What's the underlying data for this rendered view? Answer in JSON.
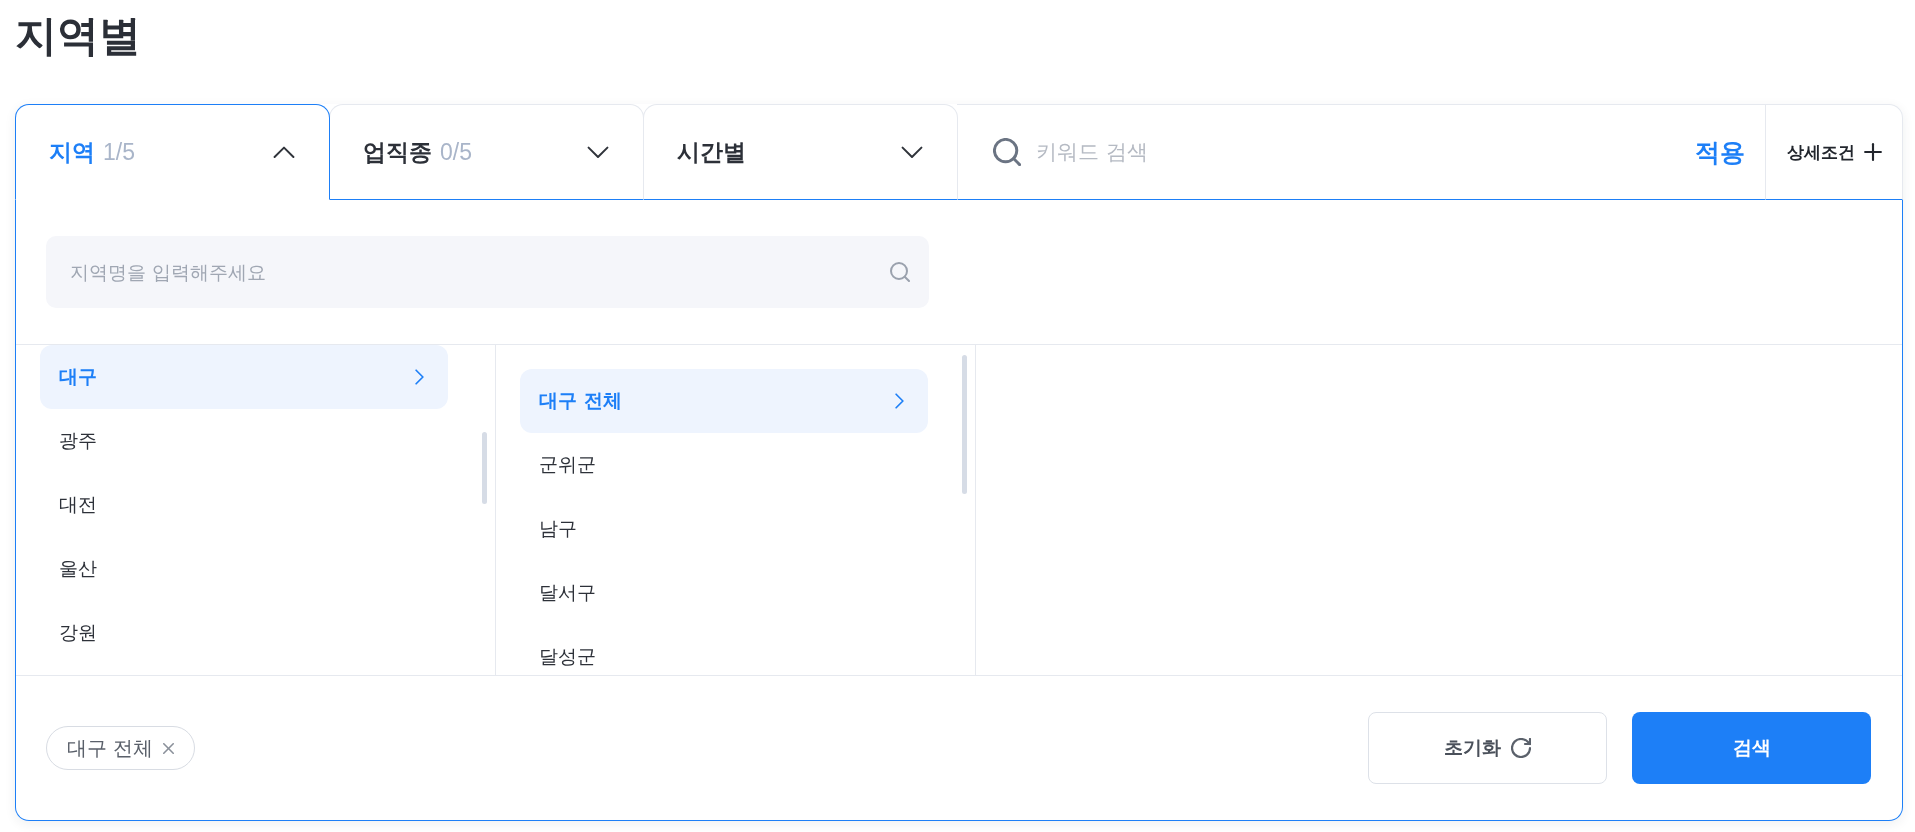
{
  "page_title": "지역별",
  "filter_tabs": [
    {
      "label": "지역",
      "count": "1/5",
      "selected": true,
      "expanded": true
    },
    {
      "label": "업직종",
      "count": "0/5",
      "selected": false,
      "expanded": false
    },
    {
      "label": "시간별",
      "selected": false,
      "expanded": false
    }
  ],
  "keyword_search": {
    "placeholder": "키워드 검색"
  },
  "apply_button": {
    "label": "적용"
  },
  "detail_button": {
    "label": "상세조건"
  },
  "region_search": {
    "placeholder": "지역명을 입력해주세요"
  },
  "region_columns": [
    {
      "items": [
        {
          "label": "대구",
          "selected": true
        },
        {
          "label": "광주",
          "selected": false
        },
        {
          "label": "대전",
          "selected": false
        },
        {
          "label": "울산",
          "selected": false
        },
        {
          "label": "강원",
          "selected": false
        }
      ]
    },
    {
      "items": [
        {
          "label": "대구 전체",
          "selected": true
        },
        {
          "label": "군위군",
          "selected": false
        },
        {
          "label": "남구",
          "selected": false
        },
        {
          "label": "달서구",
          "selected": false
        },
        {
          "label": "달성군",
          "selected": false
        }
      ]
    }
  ],
  "selected_chips": [
    {
      "label": "대구 전체"
    }
  ],
  "reset_button": {
    "label": "초기화"
  },
  "search_button": {
    "label": "검색"
  }
}
